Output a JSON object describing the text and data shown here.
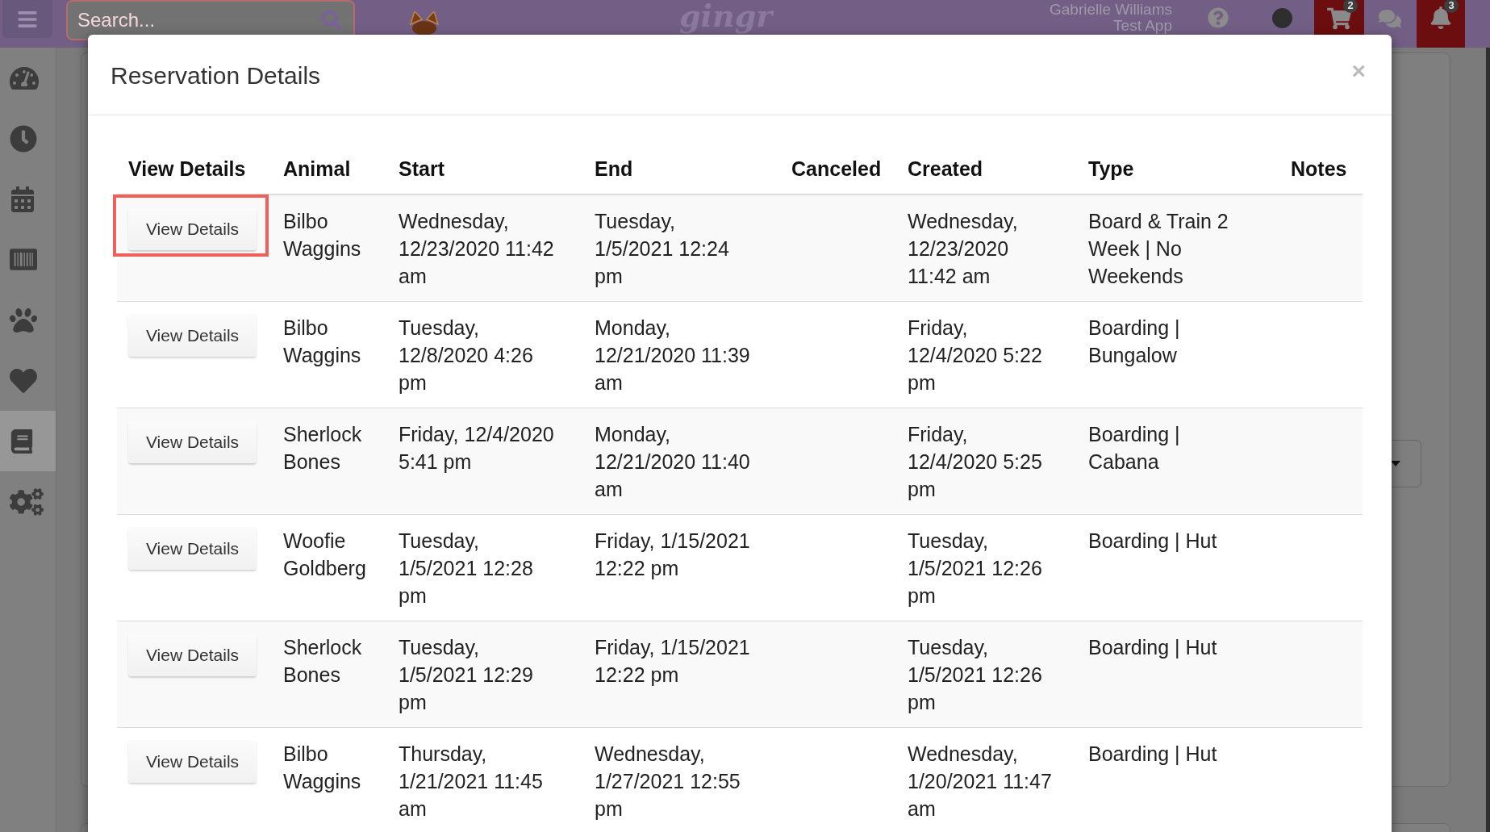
{
  "top_bar": {
    "search": {
      "placeholder": "Search..."
    },
    "logo_text": "gingr",
    "user": {
      "name": "Gabrielle Williams",
      "account": "Test App"
    },
    "cart": {
      "badge": "2"
    },
    "notifications": {
      "badge": "3"
    }
  },
  "sidebar": {
    "items": [
      {
        "selected": false
      },
      {
        "selected": false
      },
      {
        "selected": false
      },
      {
        "selected": false
      },
      {
        "selected": false
      },
      {
        "selected": false
      },
      {
        "selected": true
      },
      {
        "selected": false
      }
    ]
  },
  "modal": {
    "title": "Reservation Details",
    "close_label": "×",
    "table": {
      "columns": [
        "View Details",
        "Animal",
        "Start",
        "End",
        "Canceled",
        "Created",
        "Type",
        "Notes"
      ],
      "rows": [
        {
          "button": "View Details",
          "highlighted": true,
          "animal": "Bilbo Waggins",
          "start": "Wednesday, 12/23/2020 11:42 am",
          "end": "Tuesday, 1/5/2021 12:24 pm",
          "created": "Wednesday, 12/23/2020 11:42 am",
          "type": "Board & Train 2 Week | No Weekends"
        },
        {
          "button": "View Details",
          "highlighted": false,
          "animal": "Bilbo Waggins",
          "start": "Tuesday, 12/8/2020 4:26 pm",
          "end": "Monday, 12/21/2020 11:39 am",
          "created": "Friday, 12/4/2020 5:22 pm",
          "type": "Boarding | Bungalow"
        },
        {
          "button": "View Details",
          "highlighted": false,
          "animal": "Sherlock Bones",
          "start": "Friday, 12/4/2020 5:41 pm",
          "end": "Monday, 12/21/2020 11:40 am",
          "created": "Friday, 12/4/2020 5:25 pm",
          "type": "Boarding | Cabana"
        },
        {
          "button": "View Details",
          "highlighted": false,
          "animal": "Woofie Goldberg",
          "start": "Tuesday, 1/5/2021 12:28 pm",
          "end": "Friday, 1/15/2021 12:22 pm",
          "created": "Tuesday, 1/5/2021 12:26 pm",
          "type": "Boarding | Hut"
        },
        {
          "button": "View Details",
          "highlighted": false,
          "animal": "Sherlock Bones",
          "start": "Tuesday, 1/5/2021 12:29 pm",
          "end": "Friday, 1/15/2021 12:22 pm",
          "created": "Tuesday, 1/5/2021 12:26 pm",
          "type": "Boarding | Hut"
        },
        {
          "button": "View Details",
          "highlighted": false,
          "animal": "Bilbo Waggins",
          "start": "Thursday, 1/21/2021 11:45 am",
          "end": "Wednesday, 1/27/2021 12:55 pm",
          "created": "Wednesday, 1/20/2021 11:47 am",
          "type": "Boarding | Hut"
        }
      ]
    }
  }
}
